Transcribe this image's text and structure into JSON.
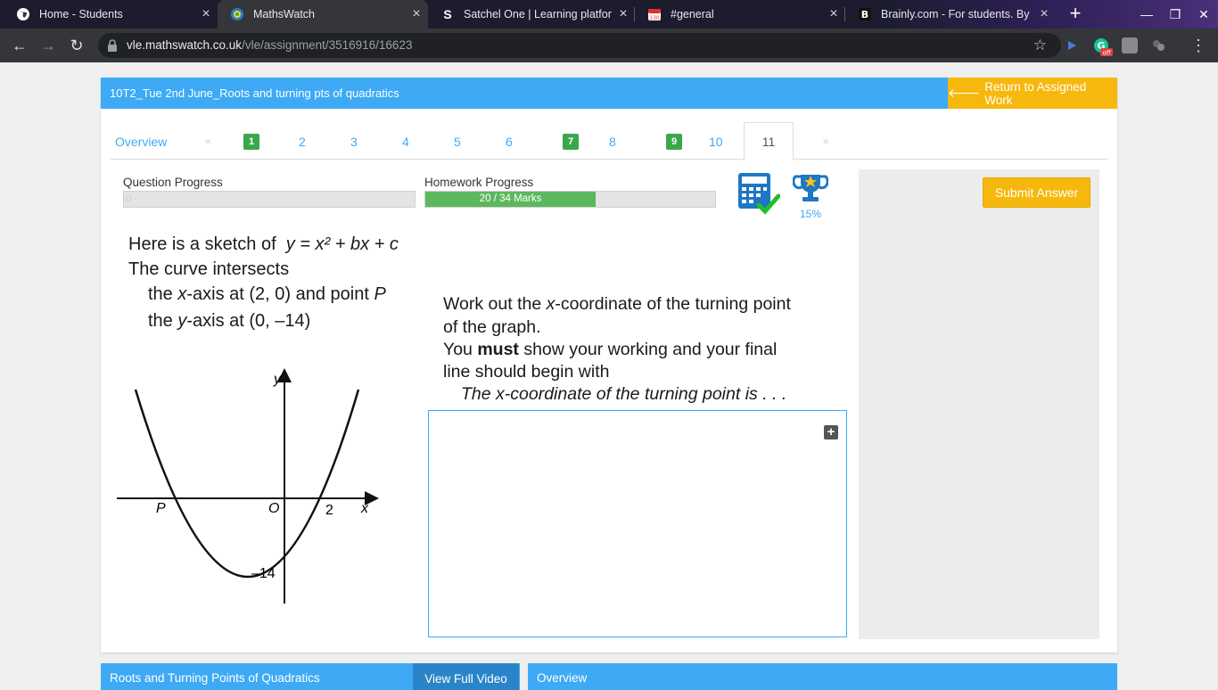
{
  "browser": {
    "tabs": [
      {
        "title": "Home - Students",
        "icon": "globe-icon"
      },
      {
        "title": "MathsWatch",
        "icon": "mathswatch-icon"
      },
      {
        "title": "Satchel One | Learning platform",
        "icon": "satchel-icon"
      },
      {
        "title": "#general",
        "icon": "calendar-icon",
        "badge": "130"
      },
      {
        "title": "Brainly.com - For students. By s",
        "icon": "brainly-icon"
      }
    ],
    "url_host": "vle.mathswatch.co.uk",
    "url_path": "/vle/assignment/3516916/16623",
    "grammarly_badge": "off"
  },
  "header": {
    "title": "10T2_Tue 2nd June_Roots and turning pts of quadratics",
    "return_label": "Return to Assigned Work"
  },
  "question_nav": {
    "overview_label": "Overview",
    "prev_arrow": "«",
    "next_arrow": "»",
    "items": [
      {
        "label": "1",
        "done": true
      },
      {
        "label": "2",
        "done": false
      },
      {
        "label": "3",
        "done": false
      },
      {
        "label": "4",
        "done": false
      },
      {
        "label": "5",
        "done": false
      },
      {
        "label": "6",
        "done": false
      },
      {
        "label": "7",
        "done": true
      },
      {
        "label": "8",
        "done": false
      },
      {
        "label": "9",
        "done": true
      },
      {
        "label": "10",
        "done": false
      },
      {
        "label": "11",
        "current": true
      }
    ]
  },
  "progress": {
    "question_label": "Question Progress",
    "question_value": "0",
    "question_fraction": 0,
    "homework_label": "Homework Progress",
    "homework_text": "20 / 34 Marks",
    "homework_fraction": 0.588,
    "trophy_percent": "15%"
  },
  "submit_label": "Submit Answer",
  "question": {
    "line1_prefix": "Here is a sketch of",
    "line1_eq": "y = x² + bx + c",
    "line2": "The curve intersects",
    "line3_a": "the ",
    "line3_x": "x",
    "line3_b": "-axis at (2, 0) and point ",
    "line3_p": "P",
    "line4_a": "the ",
    "line4_y": "y",
    "line4_b": "-axis at (0, –14)",
    "task1_a": "Work out the ",
    "task1_x": "x",
    "task1_b": "-coordinate of the turning point",
    "task2": "of the graph.",
    "task3_a": "You ",
    "task3_must": "must",
    "task3_b": " show your working and your final",
    "task4": "line should begin with",
    "task5": "The x-coordinate of the turning point is . . ."
  },
  "graph_labels": {
    "y_axis": "y",
    "x_axis": "x",
    "origin": "O",
    "p_point": "P",
    "x_intercept": "2",
    "y_intercept": "–14"
  },
  "bottom": {
    "left_title": "Roots and Turning Points of Quadratics",
    "video_label": "View Full Video",
    "right_title": "Overview"
  }
}
